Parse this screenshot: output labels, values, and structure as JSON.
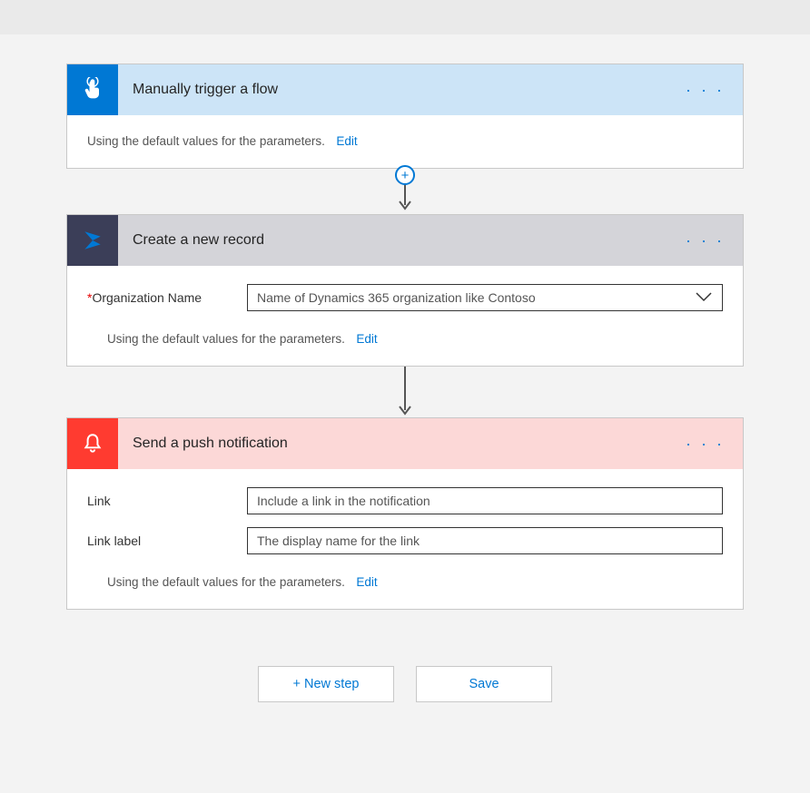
{
  "steps": {
    "trigger": {
      "title": "Manually trigger a flow",
      "defaults_text": "Using the default values for the parameters.",
      "edit_label": "Edit"
    },
    "create_record": {
      "title": "Create a new record",
      "field_label": "Organization Name",
      "field_placeholder": "Name of Dynamics 365 organization like Contoso",
      "defaults_text": "Using the default values for the parameters.",
      "edit_label": "Edit"
    },
    "push_notification": {
      "title": "Send a push notification",
      "link_label": "Link",
      "link_placeholder": "Include a link in the notification",
      "linklabel_label": "Link label",
      "linklabel_placeholder": "The display name for the link",
      "defaults_text": "Using the default values for the parameters.",
      "edit_label": "Edit"
    }
  },
  "footer": {
    "new_step": "+ New step",
    "save": "Save"
  }
}
